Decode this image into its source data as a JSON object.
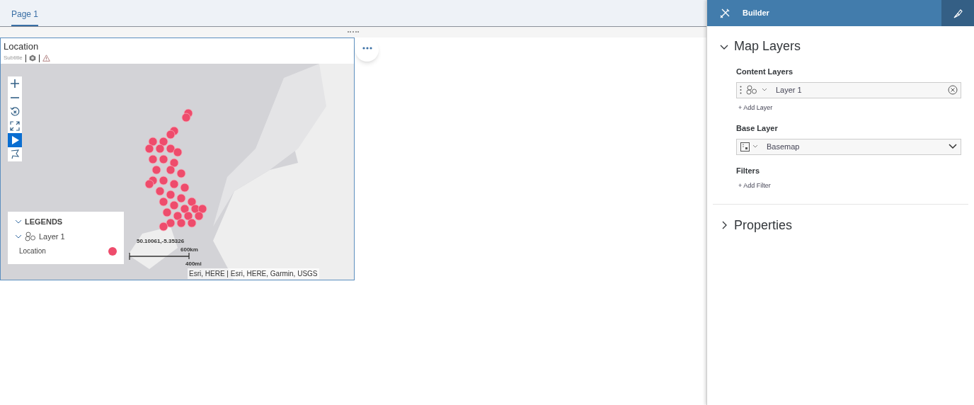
{
  "page_tabs": [
    {
      "label": "Page 1",
      "selected": true
    }
  ],
  "widget": {
    "title": "Location",
    "subtitle": "Subtitle",
    "map": {
      "controls": [
        {
          "kind": "zoom-in",
          "selected": false
        },
        {
          "kind": "zoom-out",
          "selected": false
        },
        {
          "kind": "reset",
          "selected": false
        },
        {
          "kind": "fullscreen",
          "selected": false
        },
        {
          "kind": "select",
          "selected": true
        },
        {
          "kind": "lasso",
          "selected": false
        }
      ],
      "legend": {
        "title": "LEGENDS",
        "expanded": true,
        "layers": [
          {
            "name": "Layer 1",
            "expanded": true,
            "items": [
              {
                "label": "Location",
                "color": "#ee4c6c"
              }
            ]
          }
        ]
      },
      "coordinates": "50.10061,-5.35326",
      "scale": {
        "metric": "600km",
        "imperial": "400mi"
      },
      "attribution": "Esri, HERE | Esri, HERE, Garmin, USGS"
    }
  },
  "builder": {
    "title": "Builder",
    "sections": [
      {
        "title": "Map Layers",
        "expanded": true,
        "groups": [
          {
            "kind": "layers",
            "label": "Content Layers",
            "value": "Layer 1",
            "add": "+ Add Layer"
          },
          {
            "kind": "dropdown",
            "label": "Base Layer",
            "value": "Basemap"
          },
          {
            "kind": "add",
            "label": "Filters",
            "add": "+ Add Filter"
          }
        ]
      },
      {
        "title": "Properties",
        "expanded": false
      }
    ]
  }
}
